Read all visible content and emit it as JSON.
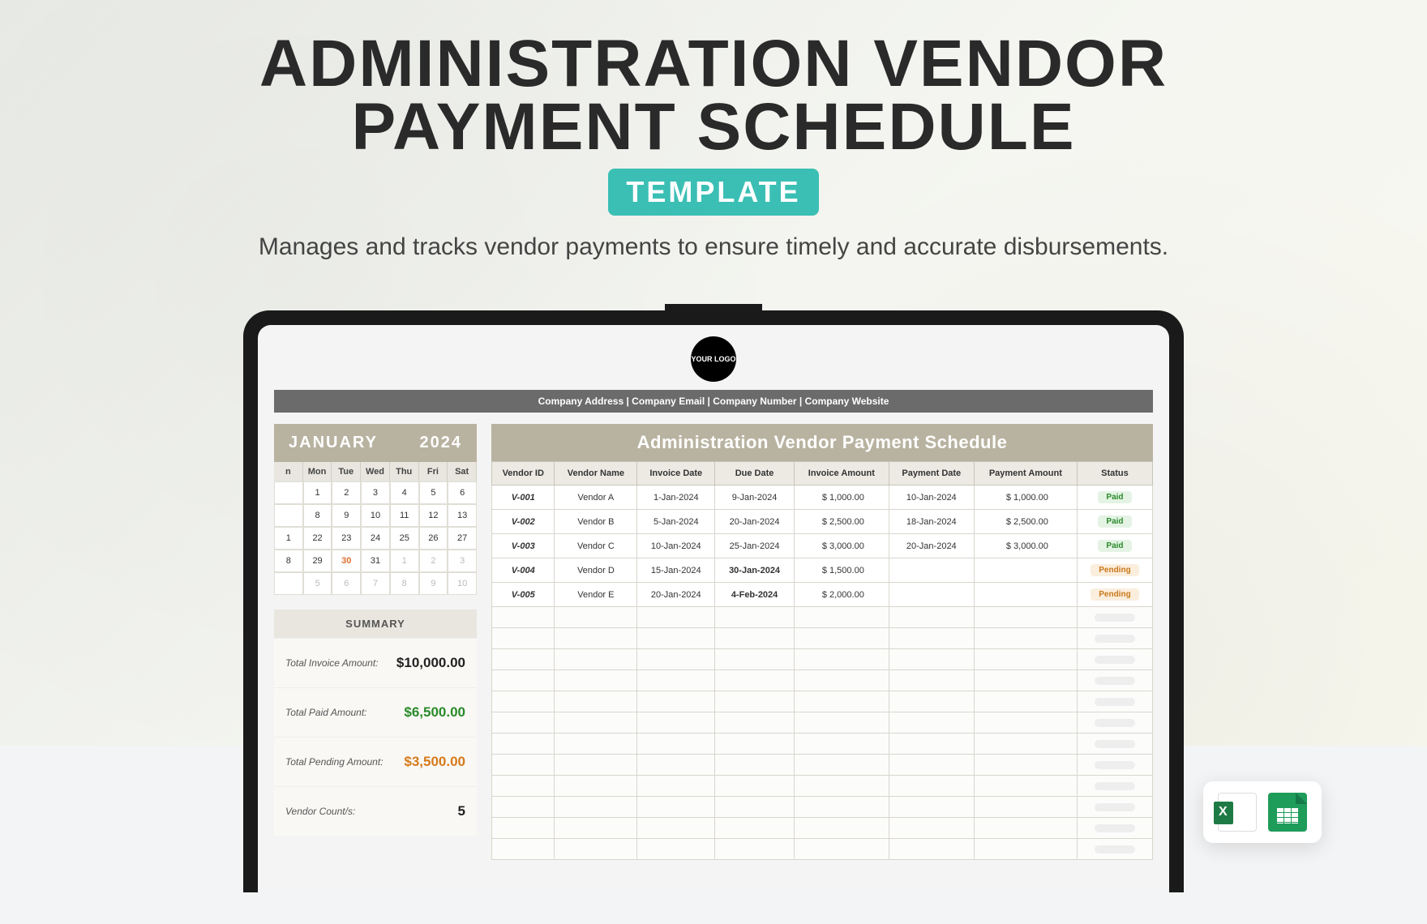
{
  "hero": {
    "title_line1": "ADMINISTRATION VENDOR",
    "title_line2": "PAYMENT SCHEDULE",
    "badge": "TEMPLATE",
    "subtitle": "Manages and tracks vendor payments to ensure timely and accurate disbursements."
  },
  "logo_text": "YOUR LOGO",
  "company_bar": "Company Address  |  Company Email  |  Company Number  |  Company Website",
  "calendar": {
    "month": "JANUARY",
    "year": "2024",
    "days": [
      "n",
      "Mon",
      "Tue",
      "Wed",
      "Thu",
      "Fri",
      "Sat"
    ],
    "rows": [
      [
        "",
        "1",
        "2",
        "3",
        "4",
        "5",
        "6"
      ],
      [
        "",
        "8",
        "9",
        "10",
        "11",
        "12",
        "13"
      ],
      [
        "1",
        "22",
        "23",
        "24",
        "25",
        "26",
        "27"
      ],
      [
        "8",
        "29",
        "30",
        "31",
        "1",
        "2",
        "3"
      ],
      [
        "",
        "5",
        "6",
        "7",
        "8",
        "9",
        "10"
      ]
    ],
    "highlight": "30"
  },
  "summary": {
    "header": "SUMMARY",
    "rows": [
      {
        "label": "Total Invoice Amount:",
        "value": "$10,000.00",
        "cls": "val-black"
      },
      {
        "label": "Total Paid Amount:",
        "value": "$6,500.00",
        "cls": "val-green"
      },
      {
        "label": "Total Pending Amount:",
        "value": "$3,500.00",
        "cls": "val-orange"
      },
      {
        "label": "Vendor Count/s:",
        "value": "5",
        "cls": "val-black"
      }
    ]
  },
  "table": {
    "title": "Administration Vendor Payment Schedule",
    "headers": [
      "Vendor ID",
      "Vendor Name",
      "Invoice Date",
      "Due Date",
      "Invoice Amount",
      "Payment Date",
      "Payment Amount",
      "Status"
    ],
    "rows": [
      {
        "id": "V-001",
        "name": "Vendor A",
        "inv": "1-Jan-2024",
        "due": "9-Jan-2024",
        "due_red": false,
        "amt": "$        1,000.00",
        "pdate": "10-Jan-2024",
        "pamt": "$        1,000.00",
        "status": "Paid"
      },
      {
        "id": "V-002",
        "name": "Vendor B",
        "inv": "5-Jan-2024",
        "due": "20-Jan-2024",
        "due_red": false,
        "amt": "$        2,500.00",
        "pdate": "18-Jan-2024",
        "pamt": "$        2,500.00",
        "status": "Paid"
      },
      {
        "id": "V-003",
        "name": "Vendor C",
        "inv": "10-Jan-2024",
        "due": "25-Jan-2024",
        "due_red": false,
        "amt": "$        3,000.00",
        "pdate": "20-Jan-2024",
        "pamt": "$        3,000.00",
        "status": "Paid"
      },
      {
        "id": "V-004",
        "name": "Vendor D",
        "inv": "15-Jan-2024",
        "due": "30-Jan-2024",
        "due_red": true,
        "amt": "$        1,500.00",
        "pdate": "",
        "pamt": "",
        "status": "Pending"
      },
      {
        "id": "V-005",
        "name": "Vendor E",
        "inv": "20-Jan-2024",
        "due": "4-Feb-2024",
        "due_red": true,
        "amt": "$        2,000.00",
        "pdate": "",
        "pamt": "",
        "status": "Pending"
      }
    ],
    "empty_rows": 12
  },
  "chart_data": {
    "type": "table",
    "title": "Administration Vendor Payment Schedule",
    "columns": [
      "Vendor ID",
      "Vendor Name",
      "Invoice Date",
      "Due Date",
      "Invoice Amount",
      "Payment Date",
      "Payment Amount",
      "Status"
    ],
    "rows": [
      [
        "V-001",
        "Vendor A",
        "1-Jan-2024",
        "9-Jan-2024",
        1000.0,
        "10-Jan-2024",
        1000.0,
        "Paid"
      ],
      [
        "V-002",
        "Vendor B",
        "5-Jan-2024",
        "20-Jan-2024",
        2500.0,
        "18-Jan-2024",
        2500.0,
        "Paid"
      ],
      [
        "V-003",
        "Vendor C",
        "10-Jan-2024",
        "25-Jan-2024",
        3000.0,
        "20-Jan-2024",
        3000.0,
        "Paid"
      ],
      [
        "V-004",
        "Vendor D",
        "15-Jan-2024",
        "30-Jan-2024",
        1500.0,
        null,
        null,
        "Pending"
      ],
      [
        "V-005",
        "Vendor E",
        "20-Jan-2024",
        "4-Feb-2024",
        2000.0,
        null,
        null,
        "Pending"
      ]
    ],
    "summary": {
      "total_invoice_amount": 10000.0,
      "total_paid_amount": 6500.0,
      "total_pending_amount": 3500.0,
      "vendor_count": 5
    }
  }
}
